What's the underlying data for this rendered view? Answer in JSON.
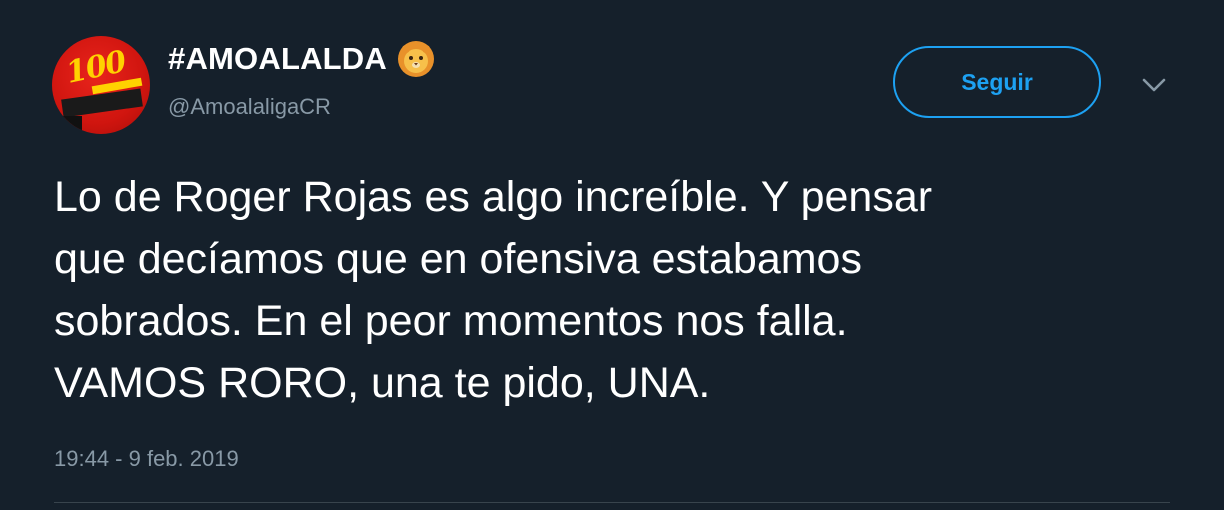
{
  "tweet": {
    "display_name": "#AMOALALDA",
    "display_name_icon": "lion-face-icon",
    "handle": "@AmoalaligaCR",
    "avatar_icon": "club-centenary-logo",
    "avatar_text": "100",
    "follow_label": "Seguir",
    "menu_icon": "chevron-down-icon",
    "text_lines": [
      "Lo de Roger Rojas es algo increíble.  Y pensar",
      "que decíamos que en ofensiva estabamos",
      "sobrados.  En el peor momentos nos falla.",
      "VAMOS RORO, una te pido, UNA."
    ],
    "timestamp": "19:44 - 9 feb. 2019"
  },
  "colors": {
    "background": "#15202b",
    "text": "#ffffff",
    "secondary_text": "#8899a6",
    "accent": "#1da1f2",
    "divider": "#38444d"
  }
}
